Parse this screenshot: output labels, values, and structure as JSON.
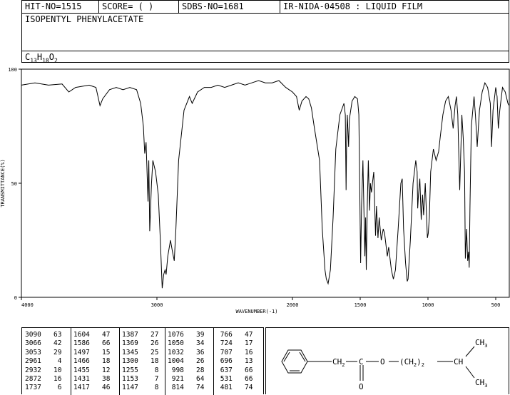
{
  "header": {
    "hit_no": "HIT-NO=1515",
    "score": "SCORE=  (   )",
    "sdbs_no": "SDBS-NO=1681",
    "ir_nida": "IR-NIDA-04508 : LIQUID FILM",
    "compound_name": "ISOPENTYL PHENYLACETATE",
    "formula_main": "C",
    "formula_c": "13",
    "formula_h_letter": "H",
    "formula_h": "18",
    "formula_o_letter": "O",
    "formula_o": "2"
  },
  "chart_data": {
    "type": "line",
    "title": "",
    "xlabel": "WAVENUMBER(-1)",
    "ylabel": "TRANSMITTANCE(%)",
    "xlim": [
      4000,
      400
    ],
    "ylim": [
      0,
      100
    ],
    "x_ticks": [
      4000,
      3000,
      2000,
      1500,
      1000,
      500
    ],
    "x_tick_labels": [
      "4000",
      "3000",
      "2000",
      "1500",
      "1000",
      "500"
    ],
    "y_ticks": [
      0,
      50,
      100
    ],
    "y_tick_labels": [
      "0",
      "50",
      "100"
    ],
    "grid": false,
    "series": [
      {
        "points": [
          [
            4000,
            93
          ],
          [
            3900,
            94
          ],
          [
            3800,
            93
          ],
          [
            3700,
            93.5
          ],
          [
            3650,
            90
          ],
          [
            3600,
            92
          ],
          [
            3500,
            93
          ],
          [
            3450,
            92
          ],
          [
            3420,
            84
          ],
          [
            3400,
            87
          ],
          [
            3350,
            91
          ],
          [
            3300,
            92
          ],
          [
            3250,
            91
          ],
          [
            3200,
            92
          ],
          [
            3150,
            91
          ],
          [
            3120,
            85
          ],
          [
            3100,
            75
          ],
          [
            3090,
            63
          ],
          [
            3080,
            68
          ],
          [
            3066,
            42
          ],
          [
            3060,
            60
          ],
          [
            3053,
            29
          ],
          [
            3040,
            50
          ],
          [
            3030,
            60
          ],
          [
            3010,
            55
          ],
          [
            2990,
            45
          ],
          [
            2975,
            25
          ],
          [
            2961,
            4
          ],
          [
            2950,
            10
          ],
          [
            2940,
            12
          ],
          [
            2932,
            10
          ],
          [
            2920,
            18
          ],
          [
            2900,
            25
          ],
          [
            2885,
            20
          ],
          [
            2872,
            16
          ],
          [
            2860,
            30
          ],
          [
            2840,
            60
          ],
          [
            2800,
            82
          ],
          [
            2760,
            88
          ],
          [
            2740,
            85
          ],
          [
            2700,
            90
          ],
          [
            2650,
            92
          ],
          [
            2600,
            92
          ],
          [
            2550,
            93
          ],
          [
            2500,
            92
          ],
          [
            2450,
            93
          ],
          [
            2400,
            94
          ],
          [
            2350,
            93
          ],
          [
            2300,
            94
          ],
          [
            2250,
            95
          ],
          [
            2200,
            94
          ],
          [
            2150,
            94
          ],
          [
            2100,
            95
          ],
          [
            2050,
            92
          ],
          [
            2000,
            90
          ],
          [
            1970,
            88
          ],
          [
            1950,
            82
          ],
          [
            1930,
            86
          ],
          [
            1900,
            88
          ],
          [
            1880,
            87
          ],
          [
            1860,
            83
          ],
          [
            1840,
            75
          ],
          [
            1800,
            60
          ],
          [
            1780,
            30
          ],
          [
            1760,
            12
          ],
          [
            1750,
            8
          ],
          [
            1737,
            6
          ],
          [
            1720,
            12
          ],
          [
            1700,
            35
          ],
          [
            1680,
            65
          ],
          [
            1650,
            80
          ],
          [
            1620,
            85
          ],
          [
            1610,
            80
          ],
          [
            1604,
            47
          ],
          [
            1600,
            70
          ],
          [
            1595,
            80
          ],
          [
            1586,
            66
          ],
          [
            1580,
            78
          ],
          [
            1560,
            86
          ],
          [
            1540,
            88
          ],
          [
            1520,
            87
          ],
          [
            1510,
            80
          ],
          [
            1497,
            15
          ],
          [
            1490,
            40
          ],
          [
            1480,
            60
          ],
          [
            1466,
            18
          ],
          [
            1460,
            35
          ],
          [
            1455,
            12
          ],
          [
            1448,
            40
          ],
          [
            1440,
            60
          ],
          [
            1431,
            38
          ],
          [
            1425,
            50
          ],
          [
            1417,
            46
          ],
          [
            1410,
            50
          ],
          [
            1400,
            55
          ],
          [
            1387,
            27
          ],
          [
            1380,
            40
          ],
          [
            1369,
            26
          ],
          [
            1360,
            35
          ],
          [
            1345,
            25
          ],
          [
            1330,
            30
          ],
          [
            1320,
            28
          ],
          [
            1300,
            18
          ],
          [
            1290,
            22
          ],
          [
            1270,
            12
          ],
          [
            1255,
            8
          ],
          [
            1240,
            12
          ],
          [
            1220,
            30
          ],
          [
            1200,
            50
          ],
          [
            1190,
            52
          ],
          [
            1180,
            30
          ],
          [
            1165,
            15
          ],
          [
            1153,
            7
          ],
          [
            1147,
            8
          ],
          [
            1130,
            25
          ],
          [
            1110,
            50
          ],
          [
            1090,
            60
          ],
          [
            1080,
            55
          ],
          [
            1076,
            39
          ],
          [
            1070,
            45
          ],
          [
            1060,
            52
          ],
          [
            1050,
            34
          ],
          [
            1040,
            45
          ],
          [
            1032,
            36
          ],
          [
            1020,
            50
          ],
          [
            1004,
            26
          ],
          [
            998,
            28
          ],
          [
            990,
            35
          ],
          [
            980,
            55
          ],
          [
            960,
            65
          ],
          [
            940,
            60
          ],
          [
            921,
            64
          ],
          [
            910,
            70
          ],
          [
            890,
            80
          ],
          [
            870,
            86
          ],
          [
            850,
            88
          ],
          [
            830,
            82
          ],
          [
            814,
            74
          ],
          [
            800,
            84
          ],
          [
            790,
            88
          ],
          [
            780,
            80
          ],
          [
            766,
            47
          ],
          [
            750,
            80
          ],
          [
            740,
            70
          ],
          [
            730,
            55
          ],
          [
            724,
            17
          ],
          [
            715,
            30
          ],
          [
            707,
            16
          ],
          [
            700,
            20
          ],
          [
            696,
            13
          ],
          [
            690,
            40
          ],
          [
            680,
            75
          ],
          [
            660,
            88
          ],
          [
            650,
            80
          ],
          [
            640,
            70
          ],
          [
            637,
            66
          ],
          [
            620,
            82
          ],
          [
            600,
            90
          ],
          [
            580,
            94
          ],
          [
            560,
            92
          ],
          [
            540,
            85
          ],
          [
            531,
            66
          ],
          [
            520,
            82
          ],
          [
            500,
            92
          ],
          [
            490,
            88
          ],
          [
            481,
            74
          ],
          [
            470,
            82
          ],
          [
            450,
            92
          ],
          [
            430,
            90
          ],
          [
            410,
            85
          ],
          [
            400,
            84
          ]
        ]
      }
    ]
  },
  "peak_table": {
    "columns": [
      [
        [
          "3090",
          "63"
        ],
        [
          "3066",
          "42"
        ],
        [
          "3053",
          "29"
        ],
        [
          "2961",
          "4"
        ],
        [
          "2932",
          "10"
        ],
        [
          "2872",
          "16"
        ],
        [
          "1737",
          "6"
        ]
      ],
      [
        [
          "1604",
          "47"
        ],
        [
          "1586",
          "66"
        ],
        [
          "1497",
          "15"
        ],
        [
          "1466",
          "18"
        ],
        [
          "1455",
          "12"
        ],
        [
          "1431",
          "38"
        ],
        [
          "1417",
          "46"
        ]
      ],
      [
        [
          "1387",
          "27"
        ],
        [
          "1369",
          "26"
        ],
        [
          "1345",
          "25"
        ],
        [
          "1300",
          "18"
        ],
        [
          "1255",
          "8"
        ],
        [
          "1153",
          "7"
        ],
        [
          "1147",
          "8"
        ]
      ],
      [
        [
          "1076",
          "39"
        ],
        [
          "1050",
          "34"
        ],
        [
          "1032",
          "36"
        ],
        [
          "1004",
          "26"
        ],
        [
          "998",
          "28"
        ],
        [
          "921",
          "64"
        ],
        [
          "814",
          "74"
        ]
      ],
      [
        [
          "766",
          "47"
        ],
        [
          "724",
          "17"
        ],
        [
          "707",
          "16"
        ],
        [
          "696",
          "13"
        ],
        [
          "637",
          "66"
        ],
        [
          "531",
          "66"
        ],
        [
          "481",
          "74"
        ]
      ]
    ]
  },
  "structure": {
    "ch2_left": "CH",
    "ch2_left_sub": "2",
    "carbonyl_c": "C",
    "ester_o": "O",
    "chain": "(CH",
    "chain_sub1": "2",
    "chain_close": ")",
    "chain_sub2": "2",
    "ch": "CH",
    "ch3_top": "CH",
    "ch3_top_sub": "3",
    "ch3_bottom": "CH",
    "ch3_bottom_sub": "3",
    "carbonyl_o": "O"
  }
}
